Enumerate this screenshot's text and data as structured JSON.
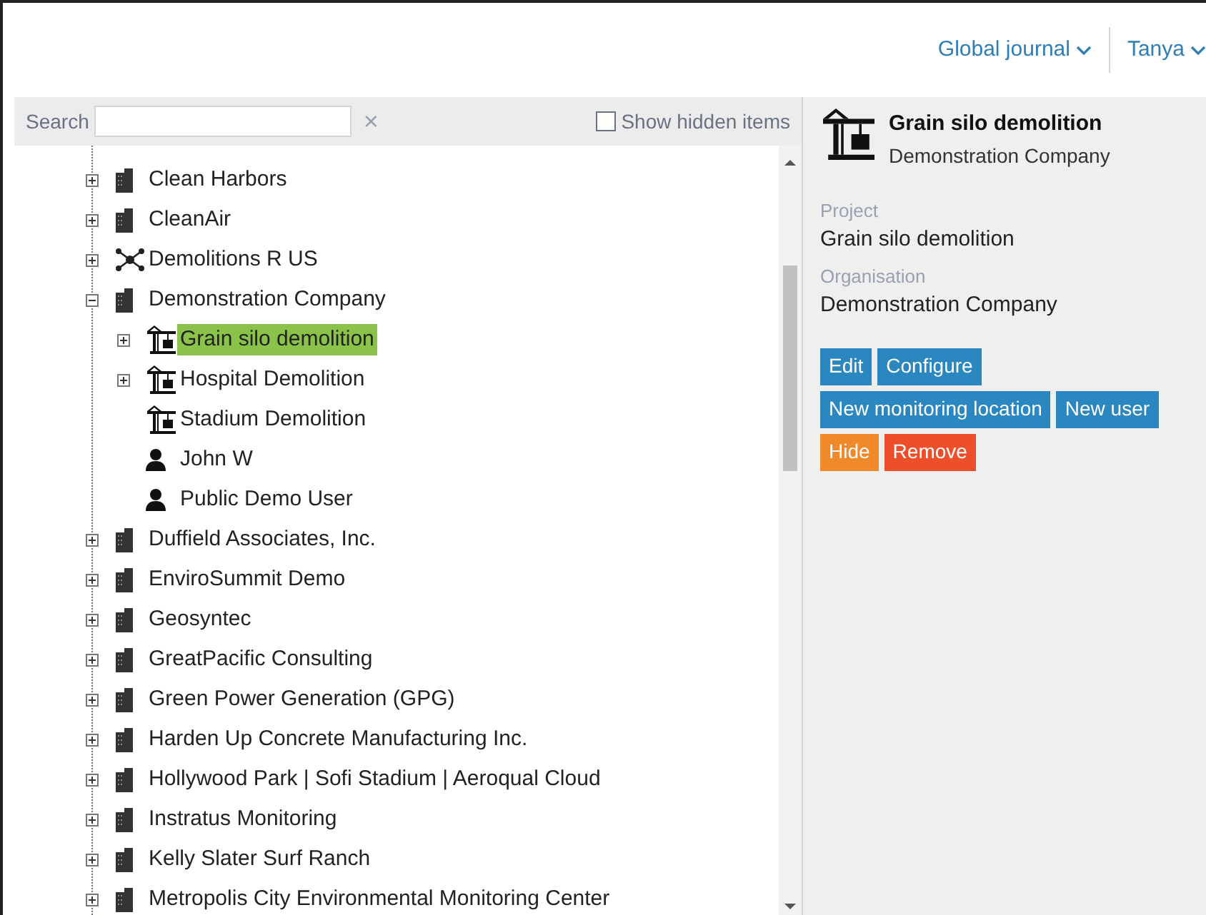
{
  "header": {
    "journal_menu": "Global journal",
    "user_menu": "Tanya"
  },
  "search": {
    "label": "Search",
    "clear": "×",
    "show_hidden": {
      "label": "Show hidden items",
      "checked": false
    }
  },
  "tree": [
    {
      "label": "Clean Harbors",
      "kind": "building",
      "expanded": false,
      "selected": false
    },
    {
      "label": "CleanAir",
      "kind": "building",
      "expanded": false,
      "selected": false
    },
    {
      "label": "Demolitions R US",
      "kind": "network",
      "expanded": false,
      "selected": false
    },
    {
      "label": "Demonstration Company",
      "kind": "building",
      "expanded": true,
      "selected": false,
      "children": [
        {
          "label": "Grain silo demolition",
          "kind": "crane",
          "expanded": false,
          "selected": true
        },
        {
          "label": "Hospital Demolition",
          "kind": "crane",
          "expanded": false,
          "selected": false
        },
        {
          "label": "Stadium Demolition",
          "kind": "crane",
          "selected": false
        },
        {
          "label": "John W",
          "kind": "user",
          "selected": false
        },
        {
          "label": "Public Demo User",
          "kind": "user",
          "selected": false
        }
      ]
    },
    {
      "label": "Duffield Associates, Inc.",
      "kind": "building",
      "expanded": false,
      "selected": false
    },
    {
      "label": "EnviroSummit Demo",
      "kind": "building",
      "expanded": false,
      "selected": false
    },
    {
      "label": "Geosyntec",
      "kind": "building",
      "expanded": false,
      "selected": false
    },
    {
      "label": "GreatPacific Consulting",
      "kind": "building",
      "expanded": false,
      "selected": false
    },
    {
      "label": "Green Power Generation (GPG)",
      "kind": "building",
      "expanded": false,
      "selected": false
    },
    {
      "label": "Harden Up Concrete Manufacturing Inc.",
      "kind": "building",
      "expanded": false,
      "selected": false
    },
    {
      "label": "Hollywood Park | Sofi Stadium | Aeroqual Cloud",
      "kind": "building",
      "expanded": false,
      "selected": false
    },
    {
      "label": "Instratus Monitoring",
      "kind": "building",
      "expanded": false,
      "selected": false
    },
    {
      "label": "Kelly Slater Surf Ranch",
      "kind": "building",
      "expanded": false,
      "selected": false
    },
    {
      "label": "Metropolis City Environmental Monitoring Center",
      "kind": "building",
      "expanded": false,
      "selected": false
    }
  ],
  "details": {
    "title": "Grain silo demolition",
    "subtitle": "Demonstration Company",
    "fields": [
      {
        "label": "Project",
        "value": "Grain silo demolition"
      },
      {
        "label": "Organisation",
        "value": "Demonstration Company"
      }
    ],
    "button_rows": [
      [
        {
          "label": "Edit",
          "kind": "primary"
        },
        {
          "label": "Configure",
          "kind": "primary"
        }
      ],
      [
        {
          "label": "New monitoring location",
          "kind": "primary"
        },
        {
          "label": "New user",
          "kind": "primary"
        }
      ],
      [
        {
          "label": "Hide",
          "kind": "warning"
        },
        {
          "label": "Remove",
          "kind": "danger"
        }
      ]
    ]
  }
}
